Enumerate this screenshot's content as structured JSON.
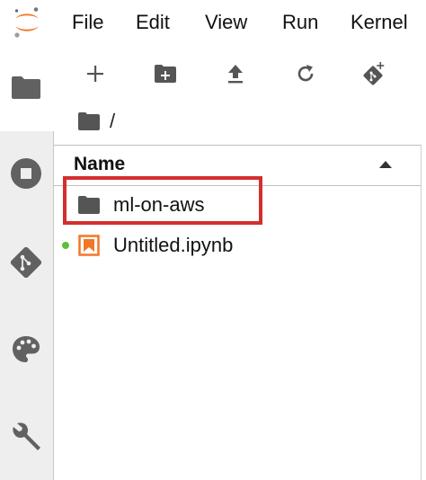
{
  "menu": {
    "items": [
      "File",
      "Edit",
      "View",
      "Run",
      "Kernel"
    ]
  },
  "activity_bar": {
    "tabs": [
      {
        "icon": "folder-icon",
        "active": true
      },
      {
        "icon": "stop-circle-icon",
        "active": false
      },
      {
        "icon": "git-icon",
        "active": false
      },
      {
        "icon": "palette-icon",
        "active": false
      },
      {
        "icon": "wrench-icon",
        "active": false
      }
    ]
  },
  "toolbar": {
    "buttons": [
      "new-launcher-icon",
      "new-folder-icon",
      "upload-icon",
      "refresh-icon",
      "git-clone-icon"
    ]
  },
  "breadcrumb": {
    "root_icon": "folder-icon",
    "separator": "/"
  },
  "file_list": {
    "header": "Name",
    "sort": "ascending",
    "items": [
      {
        "name": "ml-on-aws",
        "type": "folder",
        "running": false,
        "highlighted": true
      },
      {
        "name": "Untitled.ipynb",
        "type": "notebook",
        "running": true,
        "highlighted": false
      }
    ]
  },
  "colors": {
    "highlight": "#d32f2f",
    "running_indicator": "#5fbf3a",
    "notebook_icon": "#f37626",
    "jupyter_orange": "#f37626"
  }
}
